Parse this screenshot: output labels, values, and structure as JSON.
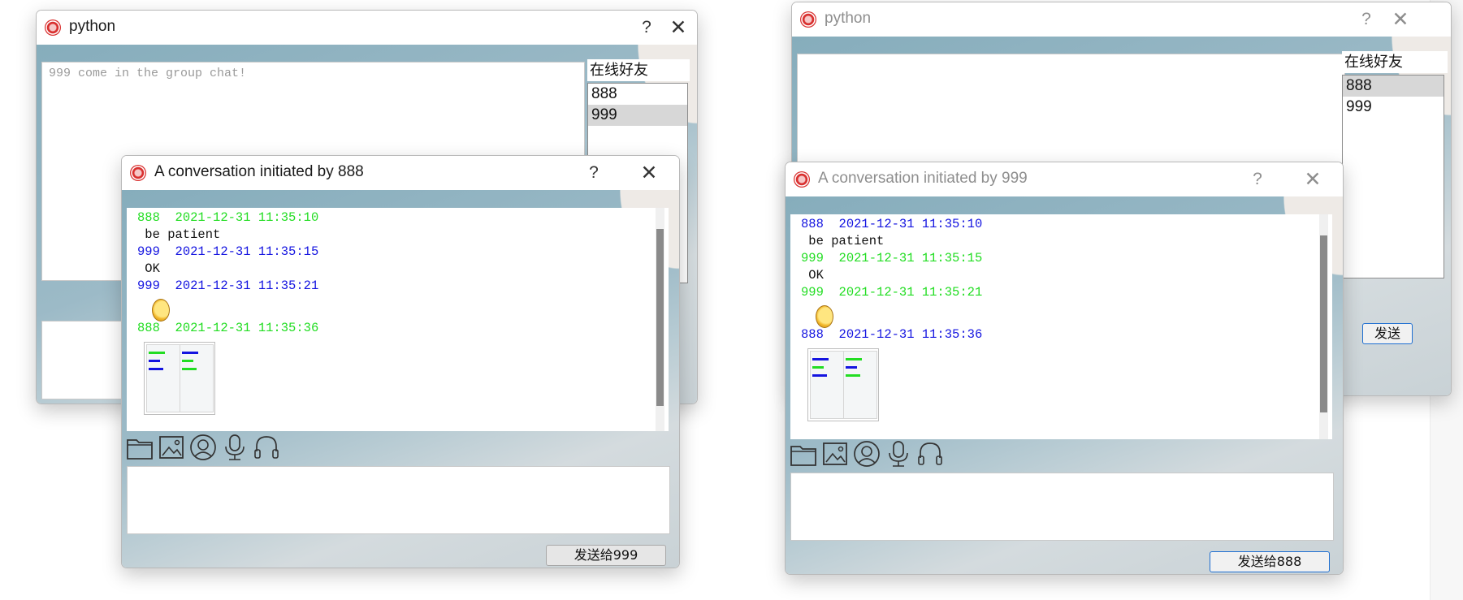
{
  "main_left": {
    "title": "python",
    "help": "?",
    "close": "✕",
    "chat_text": "999 come in the group chat!",
    "friends_header": "在线好友",
    "friends": [
      "888",
      "999"
    ]
  },
  "main_right": {
    "title": "python",
    "help": "?",
    "close": "✕",
    "friends_header": "在线好友",
    "friends": [
      "888",
      "999"
    ],
    "send_label": "发送"
  },
  "conv_left": {
    "title": "A conversation initiated by 888",
    "help": "?",
    "close": "✕",
    "messages": [
      {
        "sender": "888",
        "time": "2021-12-31 11:35:10",
        "text": " be patient"
      },
      {
        "sender": "999",
        "time": "2021-12-31 11:35:15",
        "text": " OK"
      },
      {
        "sender": "999",
        "time": "2021-12-31 11:35:21"
      },
      {
        "sender": "888",
        "time": "2021-12-31 11:35:36"
      }
    ],
    "send_label": "发送给999"
  },
  "conv_right": {
    "title": "A conversation initiated by 999",
    "help": "?",
    "close": "✕",
    "messages": [
      {
        "sender": "888",
        "time": "2021-12-31 11:35:10",
        "text": " be patient"
      },
      {
        "sender": "999",
        "time": "2021-12-31 11:35:15",
        "text": " OK"
      },
      {
        "sender": "999",
        "time": "2021-12-31 11:35:21"
      },
      {
        "sender": "888",
        "time": "2021-12-31 11:35:36"
      }
    ],
    "send_label": "发送给888"
  },
  "toolbar_icons": [
    "folder-icon",
    "image-icon",
    "person-icon",
    "microphone-icon",
    "headset-icon"
  ],
  "colors": {
    "self": "#22dd22",
    "other": "#1414e0",
    "bg_accent": "#86adbc"
  }
}
